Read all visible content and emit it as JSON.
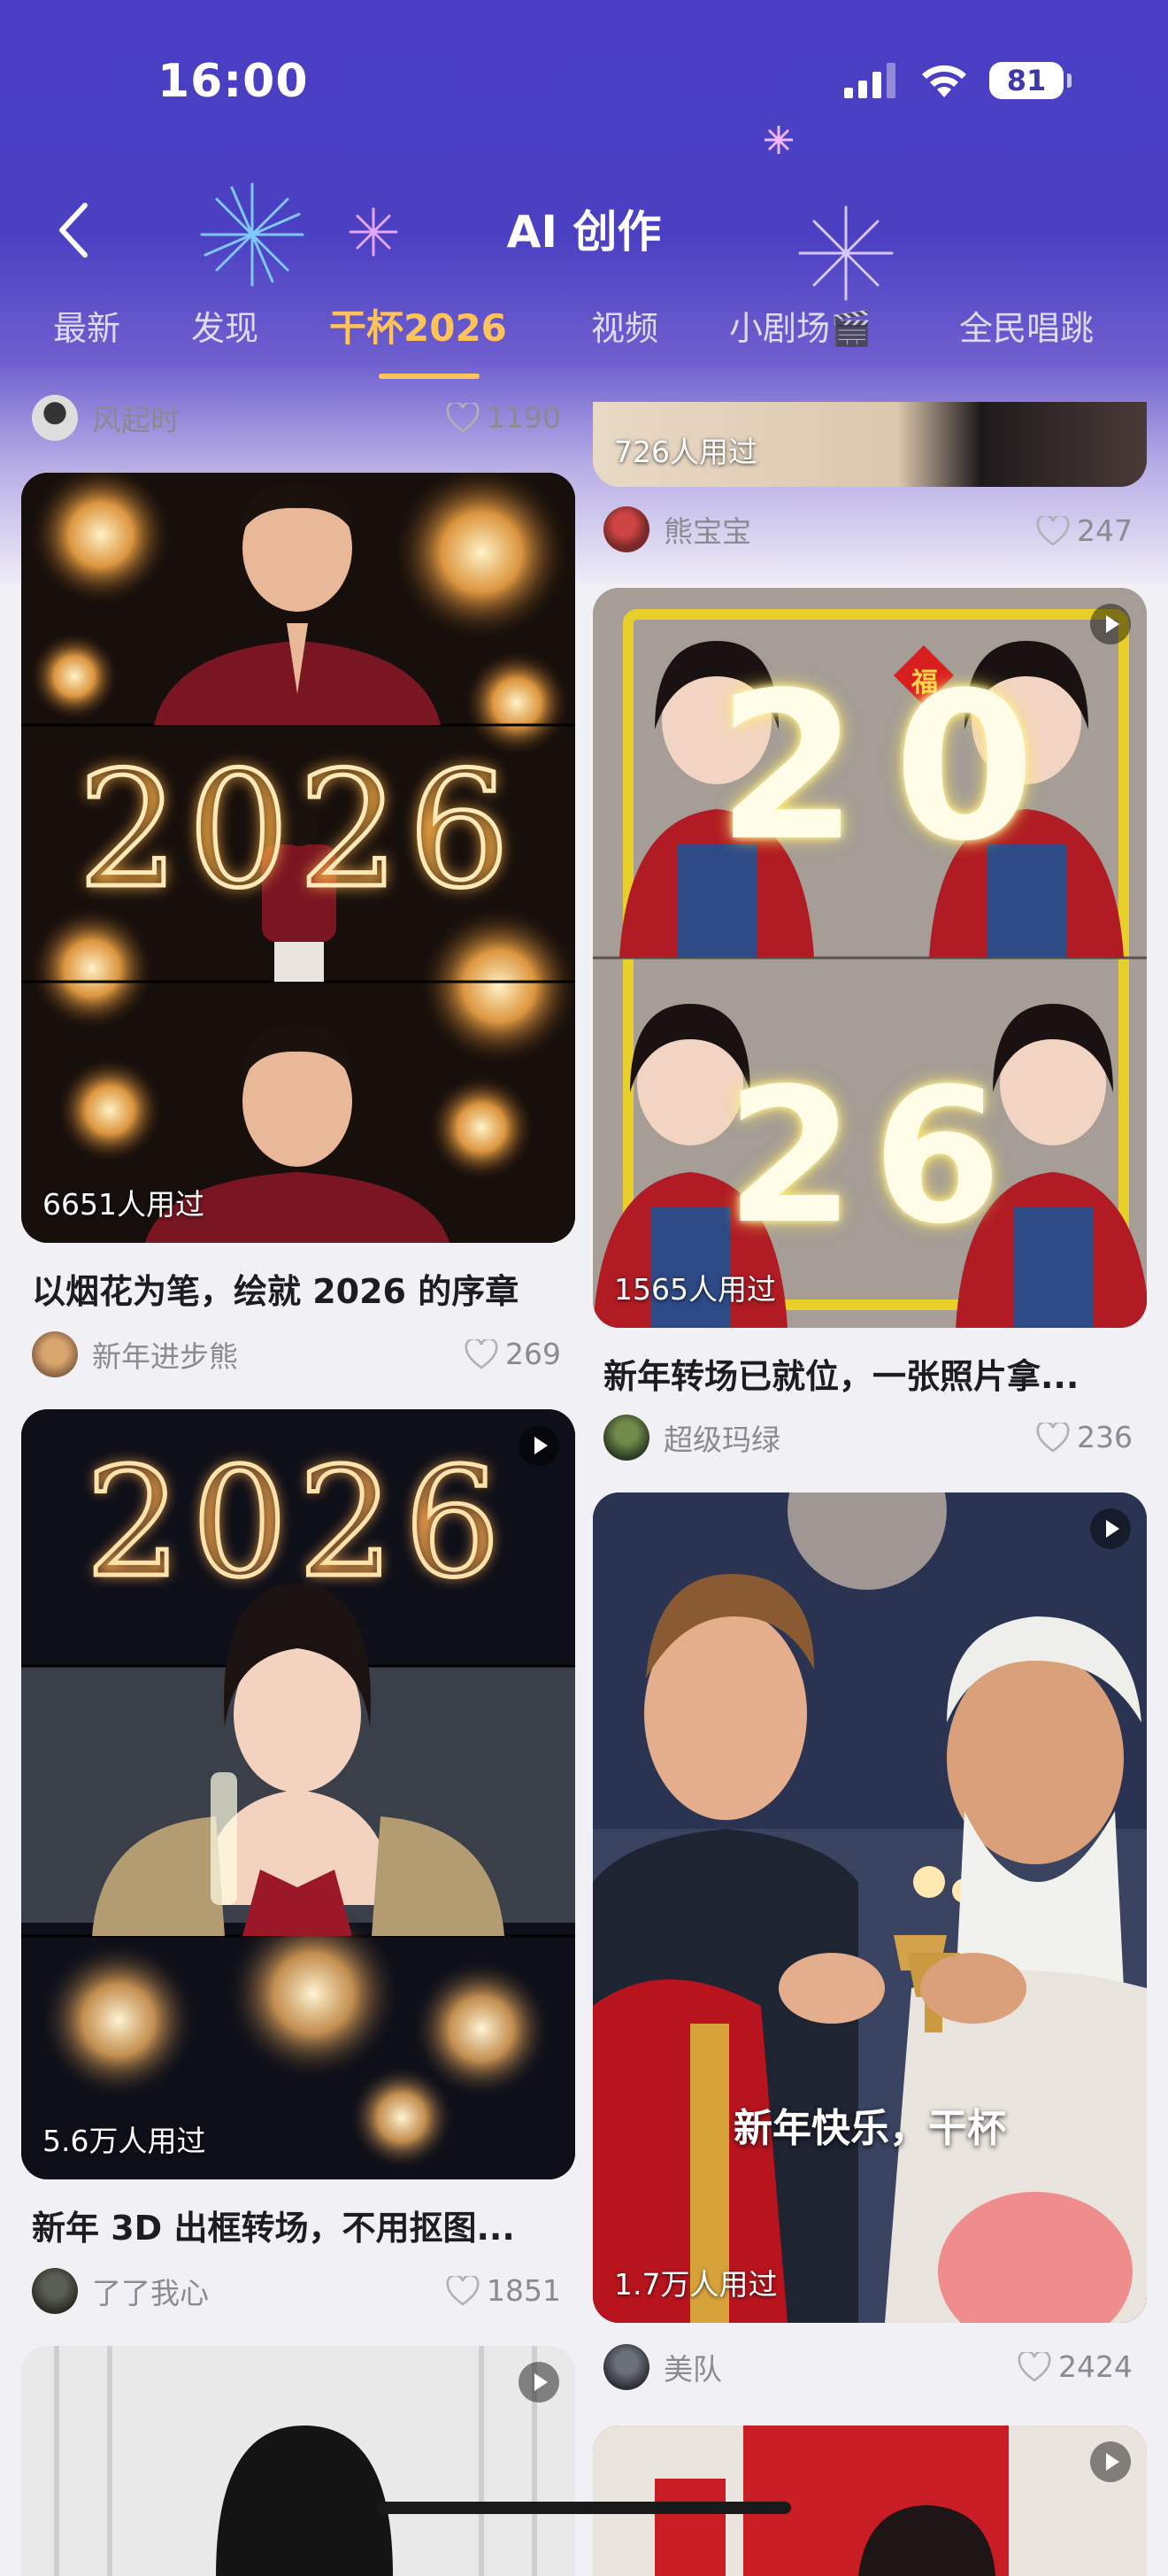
{
  "status_bar": {
    "time": "16:00",
    "battery": "81"
  },
  "header": {
    "title": "AI 创作",
    "back_icon": "chevron-left-icon"
  },
  "tabs": [
    {
      "label": "最新"
    },
    {
      "label": "发现"
    },
    {
      "label": "干杯2026",
      "active": true
    },
    {
      "label": "视频"
    },
    {
      "label": "小剧场🎬"
    },
    {
      "label": "全民唱跳"
    }
  ],
  "feed": {
    "top_left": {
      "author": "风起时",
      "likes": "1190"
    },
    "top_right": {
      "usage": "726人用过",
      "author": "熊宝宝",
      "likes": "247"
    },
    "cards": [
      {
        "usage": "6651人用过",
        "title": "以烟花为笔，绘就 2026 的序章",
        "author": "新年进步熊",
        "likes": "269",
        "image_text": "2026",
        "video": false
      },
      {
        "usage": "1565人用过",
        "title": "新年转场已就位，一张照片拿...",
        "author": "超级玛绿",
        "likes": "236",
        "image_text_top": "20",
        "image_text_bottom": "26",
        "badge": "福",
        "video": true
      },
      {
        "usage": "5.6万人用过",
        "title": "新年 3D 出框转场，不用抠图...",
        "author": "了了我心",
        "likes": "1851",
        "image_text": "2026",
        "video": true
      },
      {
        "usage": "1.7万人用过",
        "overlay": "新年快乐，干杯",
        "author": "美队",
        "likes": "2424",
        "video": true
      }
    ]
  },
  "colors": {
    "header_purple": "#4a3fc4",
    "accent_gold": "#ffc35a",
    "text_gray": "#8a8a90"
  }
}
